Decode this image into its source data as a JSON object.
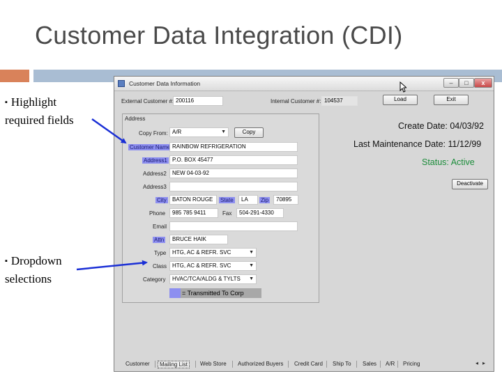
{
  "slide": {
    "title": "Customer Data Integration (CDI)",
    "bullets": [
      {
        "text": "Highlight required fields"
      },
      {
        "text": "Dropdown selections"
      }
    ],
    "bullet_symbol": "▪"
  },
  "window": {
    "title": "Customer Data Information",
    "controls": {
      "minimize": "–",
      "maximize": "□",
      "close": "x"
    },
    "external_customer": {
      "label": "External Customer #:",
      "value": "200116"
    },
    "internal_customer": {
      "label": "Internal Customer #:",
      "value": "104537"
    },
    "load_button": "Load",
    "exit_button": "Exit",
    "address_group_label": "Address",
    "copy_from": {
      "label": "Copy From:",
      "value": "A/R"
    },
    "copy_button": "Copy",
    "customer_name": {
      "label": "Customer Name",
      "value": "RAINBOW REFRIGERATION"
    },
    "address1": {
      "label": "Address1",
      "value": "P.O. BOX 45477"
    },
    "address2": {
      "label": "Address2",
      "value": "NEW 04-03-92"
    },
    "address3": {
      "label": "Address3",
      "value": ""
    },
    "city": {
      "label": "City",
      "value": "BATON ROUGE"
    },
    "state": {
      "label": "State",
      "value": "LA"
    },
    "zip": {
      "label": "Zip",
      "value": "70895"
    },
    "phone": {
      "label": "Phone",
      "value": "985 785 9411"
    },
    "fax": {
      "label": "Fax",
      "value": "504-291-4330"
    },
    "email": {
      "label": "Email",
      "value": ""
    },
    "attn": {
      "label": "Attn",
      "value": "BRUCE HAIK"
    },
    "type": {
      "label": "Type",
      "value": "HTG, AC & REFR. SVC"
    },
    "class": {
      "label": "Class",
      "value": "HTG, AC & REFR. SVC"
    },
    "category": {
      "label": "Category",
      "value": "HVAC/TCA/ALDG & TYLTS"
    },
    "legend": "= Transmitted To Corp",
    "create_date": "Create Date: 04/03/92",
    "last_maintenance_date": "Last Maintenance Date: 11/12/99",
    "status": "Status: Active",
    "deactivate_button": "Deactivate",
    "tabs": [
      "Customer",
      "Mailing List",
      "Web Store",
      "Authorized Buyers",
      "Credit Card",
      "Ship To",
      "Sales",
      "A/R",
      "Pricing"
    ]
  },
  "colors": {
    "required_highlight": "#8d8ff0",
    "status_active": "#1b8c3a",
    "arrow": "#1a2fd6",
    "accent_orange": "#d9825a",
    "accent_blue": "#a9bdd3"
  }
}
